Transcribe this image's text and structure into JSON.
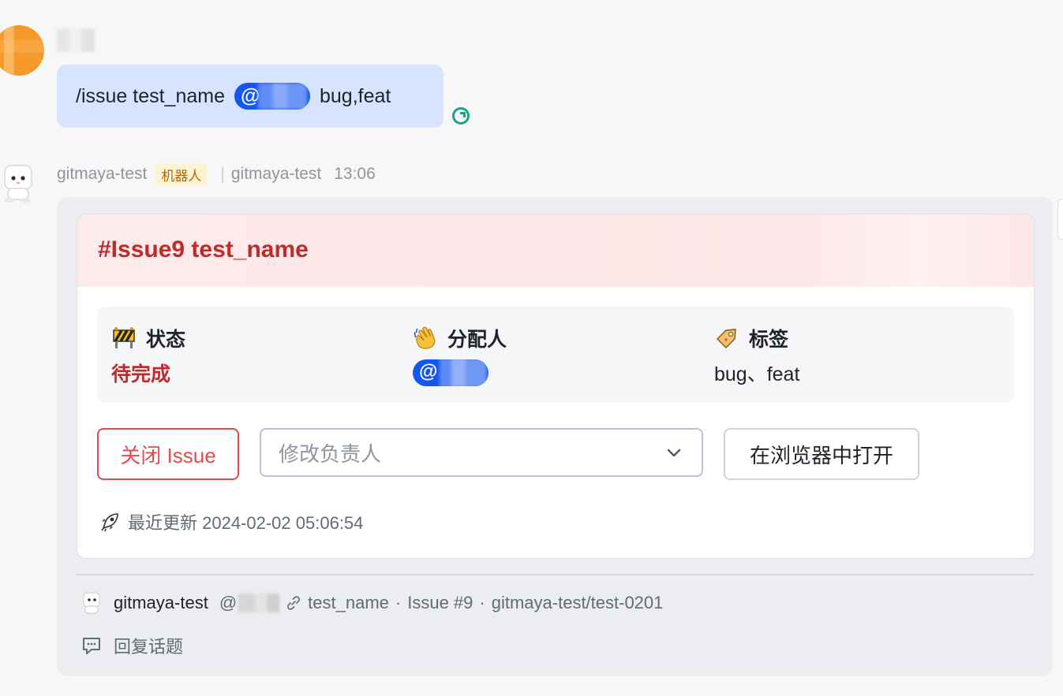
{
  "user_message": {
    "command": "/issue test_name",
    "mention_prefix": "@",
    "labels_text": "bug,feat"
  },
  "bot_message": {
    "sender": "gitmaya-test",
    "tag": "机器人",
    "app_name": "gitmaya-test",
    "time": "13:06",
    "card": {
      "title": "#Issue9 test_name",
      "status_label": "状态",
      "status_value": "待完成",
      "assignee_label": "分配人",
      "assignee_prefix": "@",
      "labels_label": "标签",
      "labels_value": "bug、feat",
      "close_button": "关闭 Issue",
      "assignee_select_placeholder": "修改负责人",
      "open_browser_button": "在浏览器中打开",
      "updated_text": "最近更新 2024-02-02 05:06:54"
    },
    "footer": {
      "name": "gitmaya-test",
      "handle_prefix": "@",
      "topic": "test_name",
      "dot": "·",
      "issue_ref": "Issue #9",
      "repo": "gitmaya-test/test-0201",
      "reply": "回复话题"
    }
  },
  "colors": {
    "bubble_bg": "#d6e4ff",
    "mention_blue": "#1456f0",
    "title_red": "#c02a2a",
    "close_red": "#e8494a",
    "read_green": "#1aa385"
  }
}
